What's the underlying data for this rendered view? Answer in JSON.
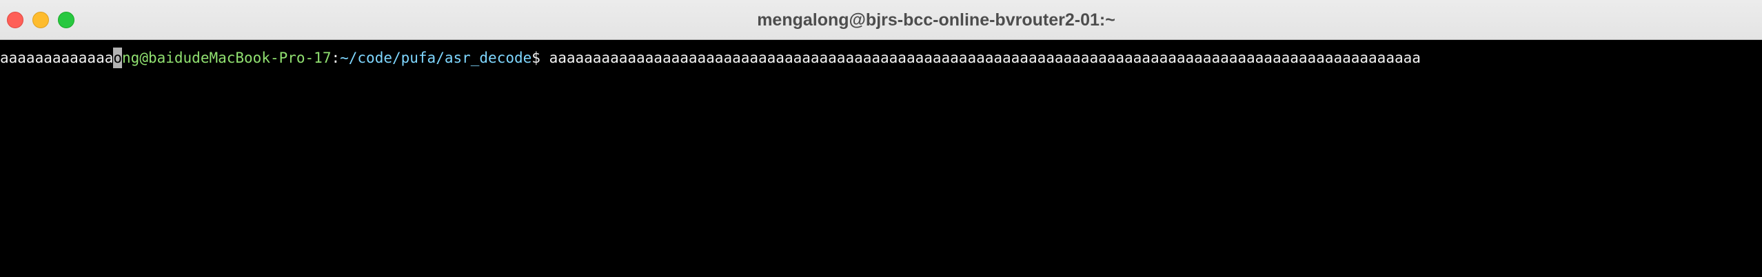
{
  "window": {
    "title": "mengalong@bjrs-bcc-online-bvrouter2-01:~"
  },
  "terminal": {
    "prefix": "aaaaaaaaaaaaa",
    "cursor_char": "o",
    "user_host": "ng@baidudeMacBook-Pro-17",
    "separator": ":",
    "path": "~/code/pufa/asr_decode",
    "prompt_symbol": "$ ",
    "command": "aaaaaaaaaaaaaaaaaaaaaaaaaaaaaaaaaaaaaaaaaaaaaaaaaaaaaaaaaaaaaaaaaaaaaaaaaaaaaaaaaaaaaaaaaaaaaaaaaaaa"
  },
  "colors": {
    "close": "#fe5f57",
    "minimize": "#febc2e",
    "zoom": "#28c840",
    "user_host": "#90e070",
    "path": "#7fd7ff",
    "background": "#000000",
    "text": "#f2f2f2"
  }
}
